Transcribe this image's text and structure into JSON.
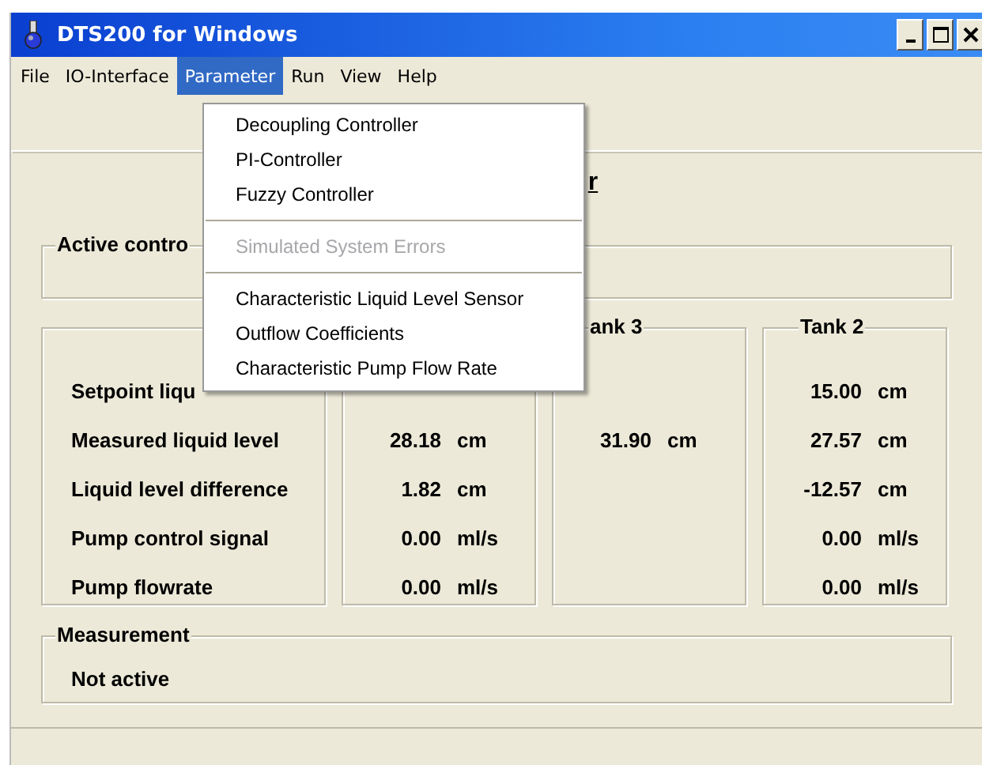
{
  "window": {
    "title": "DTS200 for Windows"
  },
  "menu_bar": [
    {
      "label": "File",
      "selected": false
    },
    {
      "label": "IO-Interface",
      "selected": false
    },
    {
      "label": "Parameter",
      "selected": true
    },
    {
      "label": "Run",
      "selected": false
    },
    {
      "label": "View",
      "selected": false
    },
    {
      "label": "Help",
      "selected": false
    }
  ],
  "dropdown": [
    {
      "kind": "item",
      "label": "Decoupling Controller",
      "disabled": false
    },
    {
      "kind": "item",
      "label": "PI-Controller",
      "disabled": false
    },
    {
      "kind": "item",
      "label": "Fuzzy Controller",
      "disabled": false
    },
    {
      "kind": "separator"
    },
    {
      "kind": "item",
      "label": "Simulated System Errors",
      "disabled": true
    },
    {
      "kind": "separator"
    },
    {
      "kind": "item",
      "label": "Characteristic Liquid Level Sensor",
      "disabled": false
    },
    {
      "kind": "item",
      "label": "Outflow Coefficients",
      "disabled": false
    },
    {
      "kind": "item",
      "label": "Characteristic Pump Flow Rate",
      "disabled": false
    }
  ],
  "heading": "r",
  "active_controller": {
    "label": "Active contro"
  },
  "row_labels": [
    "Setpoint liqu",
    "Measured liquid level",
    "Liquid level difference",
    "Pump control signal",
    "Pump flowrate"
  ],
  "columns": [
    {
      "cells": [
        null,
        {
          "value": "28.18",
          "unit": "cm"
        },
        {
          "value": "1.82",
          "unit": "cm"
        },
        {
          "value": "0.00",
          "unit": "ml/s"
        },
        {
          "value": "0.00",
          "unit": "ml/s"
        }
      ]
    },
    {
      "header": "ank 3",
      "cells": [
        null,
        {
          "value": "31.90",
          "unit": "cm"
        },
        null,
        null,
        null
      ]
    },
    {
      "header": "Tank 2",
      "cells": [
        {
          "value": "15.00",
          "unit": "cm"
        },
        {
          "value": "27.57",
          "unit": "cm"
        },
        {
          "value": "-12.57",
          "unit": "cm"
        },
        {
          "value": "0.00",
          "unit": "ml/s"
        },
        {
          "value": "0.00",
          "unit": "ml/s"
        }
      ]
    }
  ],
  "measurement": {
    "title": "Measurement",
    "status": "Not active"
  }
}
